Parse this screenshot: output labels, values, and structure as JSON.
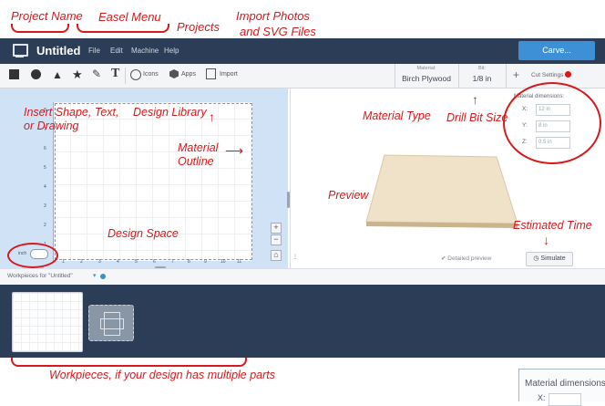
{
  "annotations": {
    "project_name": "Project Name",
    "easel_menu": "Easel Menu",
    "import_photos": "Import Photos",
    "svg_files": "and SVG Files",
    "projects": "Projects",
    "insert_shape": "Insert Shape, Text,",
    "or_drawing": "or Drawing",
    "design_library": "Design Library",
    "material": "Material",
    "outline": "Outline",
    "material_type": "Material Type",
    "drill_bit_size": "Drill Bit Size",
    "preview": "Preview",
    "estimated_time": "Estimated Time",
    "design_space": "Design Space",
    "workpieces_note": "Workpieces, if your design has multiple parts"
  },
  "app": {
    "title": "Untitled",
    "menu": [
      "File",
      "Edit",
      "Machine",
      "Help"
    ],
    "carve_button": "Carve..."
  },
  "toolbar": {
    "icons_label": "Icons",
    "apps_label": "Apps",
    "import_label": "Import",
    "material_label": "Material:",
    "material_value": "Birch Plywood",
    "bit_label": "Bit:",
    "bit_value": "1/8 in",
    "plus": "+",
    "cut_settings": "Cut Settings"
  },
  "dimensions": {
    "title": "Material dimensions:",
    "x_label": "X:",
    "x_value": "12 in",
    "y_label": "Y:",
    "y_value": "8 in",
    "z_label": "Z:",
    "z_value": "0.5 in"
  },
  "canvas": {
    "toggle_label": "inch",
    "y_ticks": [
      "8",
      "7",
      "6",
      "5",
      "4",
      "3",
      "2",
      "1"
    ],
    "x_ticks": [
      "1",
      "2",
      "3",
      "4",
      "5",
      "6",
      "7",
      "8",
      "9",
      "10",
      "11"
    ]
  },
  "preview": {
    "detailed_label": "Detailed preview",
    "simulate_label": "Simulate"
  },
  "workpieces": {
    "header": "Workpieces for \"Untitled\""
  },
  "corner_crop": {
    "title": "Material dimensions:",
    "x_label": "X:"
  },
  "colors": {
    "annotation": "#d7191c",
    "navbar": "#2c3e57",
    "carve_button": "#3d8fd6",
    "canvas_bg": "#cfe2f6"
  }
}
